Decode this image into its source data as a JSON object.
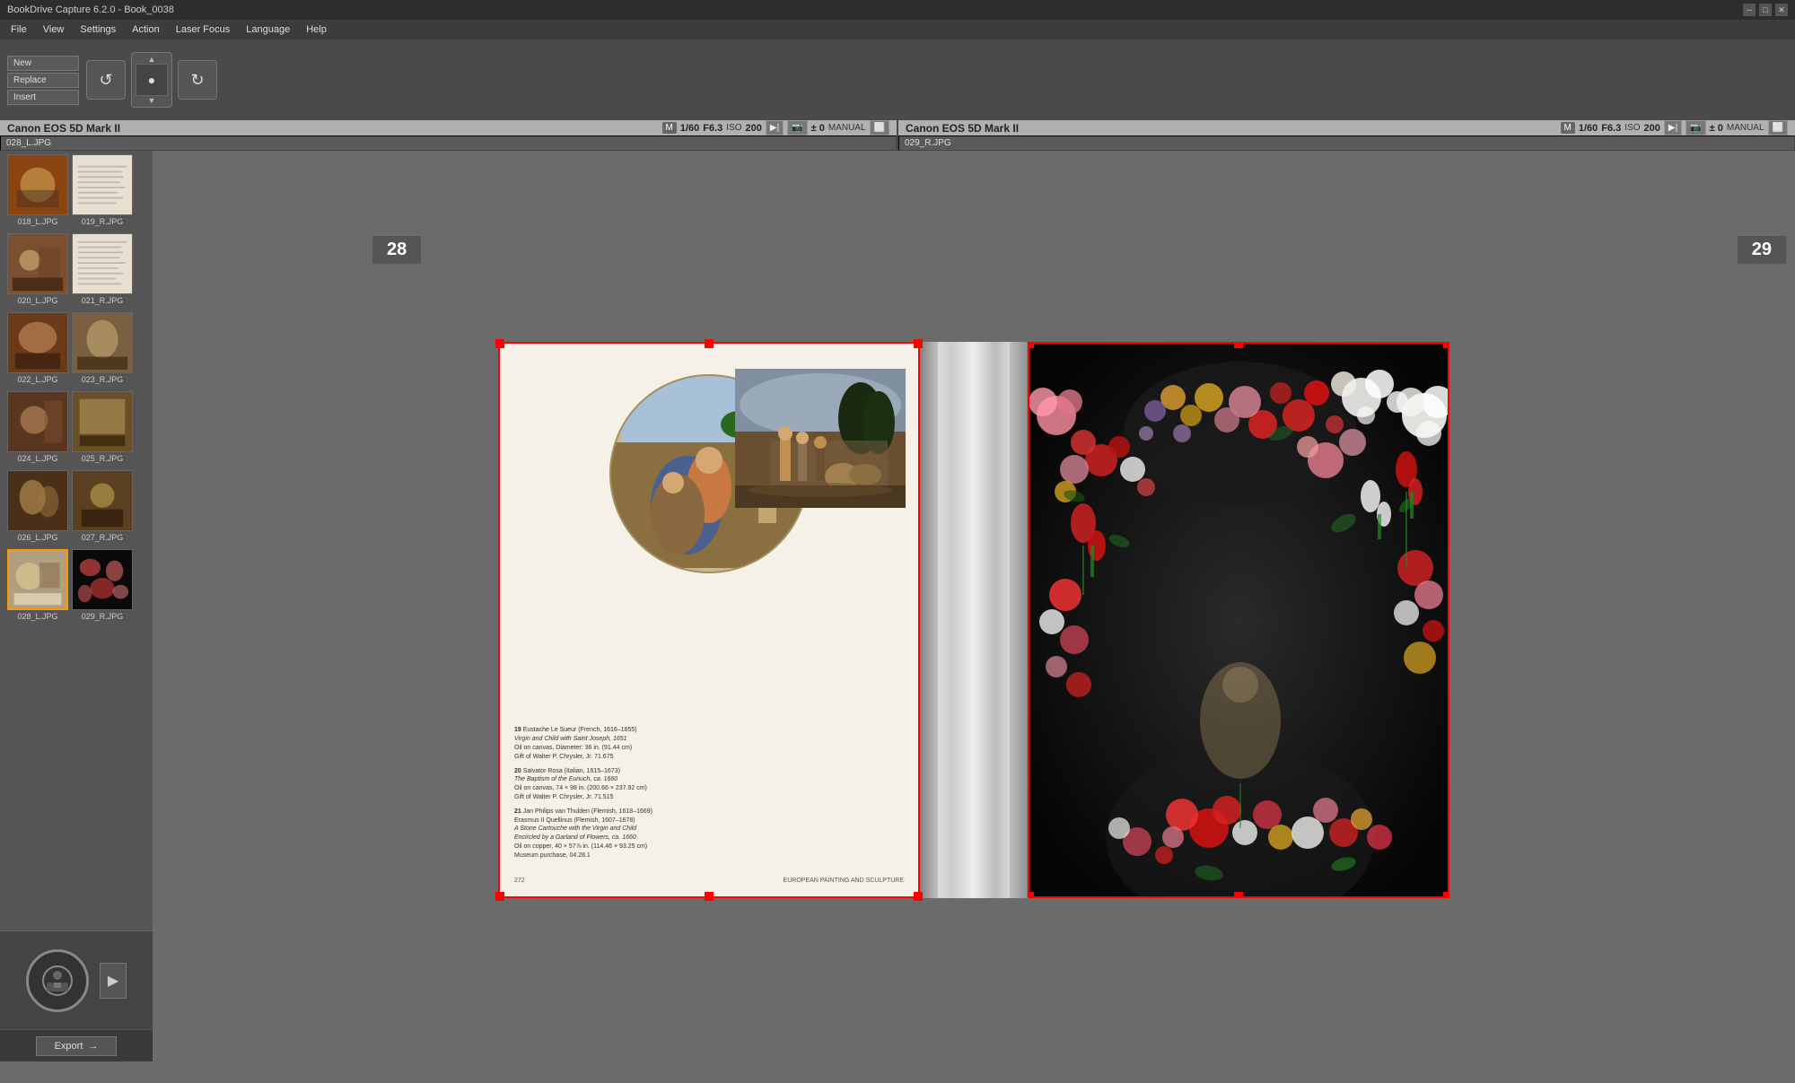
{
  "titlebar": {
    "title": "BookDrive Capture 6.2.0 - Book_0038",
    "controls": [
      "minimize",
      "maximize",
      "close"
    ]
  },
  "menubar": {
    "items": [
      "File",
      "View",
      "Settings",
      "Action",
      "Laser Focus",
      "Language",
      "Help"
    ]
  },
  "toolbar": {
    "new_label": "New",
    "replace_label": "Replace",
    "insert_label": "Insert"
  },
  "camera_left": {
    "name": "Canon EOS 5D Mark II",
    "shutter": "1/60",
    "aperture": "F6.3",
    "iso_label": "ISO",
    "iso_value": "200",
    "m_label": "M",
    "exposure": "± 0",
    "manual": "MANUAL",
    "filename": "028_L.JPG"
  },
  "camera_right": {
    "name": "Canon EOS 5D Mark II",
    "shutter": "1/60",
    "aperture": "F6.3",
    "iso_label": "ISO",
    "iso_value": "200",
    "m_label": "M",
    "exposure": "± 0",
    "manual": "MANUAL",
    "filename": "029_R.JPG"
  },
  "pages": {
    "left_number": "28",
    "right_number": "29"
  },
  "captions": {
    "item19_num": "19",
    "item19_artist": "Eustache Le Sueur (French, 1616–1655)",
    "item19_title": "Virgin and Child with Saint Joseph, 1651",
    "item19_medium": "Oil on canvas, Diameter: 36 in. (91.44 cm)",
    "item19_credit": "Gift of Walter P. Chrysler, Jr. 71.675",
    "item20_num": "20",
    "item20_artist": "Salvator Rosa (Italian, 1615–1673)",
    "item20_title": "The Baptism of the Eunuch, ca. 1660",
    "item20_medium": "Oil on canvas, 74 × 98 in. (200.66 × 237.92 cm)",
    "item20_credit": "Gift of Walter P. Chrysler, Jr. 71.515",
    "item21_num": "21",
    "item21_artist": "Jan Philips van Thulden (Flemish, 1618–1669)",
    "item21_artist2": "Erasmus II Quellinus (Flemish, 1607–1678)",
    "item21_title": "A Stone Cartouche with the Virgin and Child",
    "item21_subtitle": "Encircled by a Garland of Flowers, ca. 1660",
    "item21_medium": "Oil on copper, 40 × 57⅞ in. (114.46 × 93.25 cm)",
    "item21_credit": "Museum purchase, 04.28.1",
    "footer_page": "272",
    "footer_text": "EUROPEAN PAINTING AND SCULPTURE"
  },
  "thumbnails": [
    {
      "label": "018_L.JPG",
      "type": "painting1",
      "selected": false
    },
    {
      "label": "019_R.JPG",
      "type": "text",
      "selected": false
    },
    {
      "label": "020_L.JPG",
      "type": "painting2",
      "selected": false
    },
    {
      "label": "021_R.JPG",
      "type": "text",
      "selected": false
    },
    {
      "label": "022_L.JPG",
      "type": "painting1",
      "selected": false
    },
    {
      "label": "023_R.JPG",
      "type": "painting2",
      "selected": false
    },
    {
      "label": "024_L.JPG",
      "type": "painting1",
      "selected": false
    },
    {
      "label": "025_R.JPG",
      "type": "painting2",
      "selected": false
    },
    {
      "label": "026_L.JPG",
      "type": "painting1",
      "selected": false
    },
    {
      "label": "027_R.JPG",
      "type": "painting2",
      "selected": false
    },
    {
      "label": "028_L.JPG",
      "type": "painting1",
      "selected": true
    },
    {
      "label": "029_R.JPG",
      "type": "dark",
      "selected": false
    }
  ],
  "export_button": "Export",
  "icons": {
    "camera": "📷",
    "play": "▶",
    "rotate_left": "↺",
    "rotate_right": "↻",
    "arrow": "→",
    "video": "▶",
    "minimize": "─",
    "maximize": "□",
    "close": "✕"
  }
}
